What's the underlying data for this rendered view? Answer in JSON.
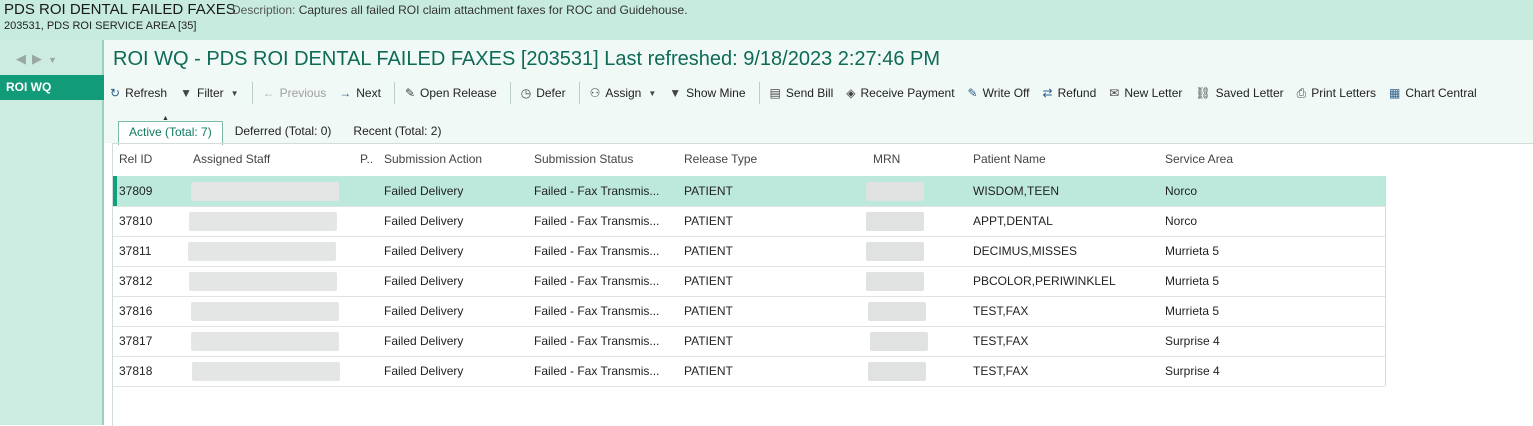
{
  "topbar": {
    "wq_name": "PDS ROI DENTAL FAILED FAXES",
    "description_label": "Description:",
    "description": "Captures all failed ROI claim attachment faxes for ROC and Guidehouse.",
    "subtitle": "203531, PDS ROI SERVICE AREA [35]"
  },
  "nav": {
    "back_icon": "back-arrow-icon",
    "forward_icon": "forward-arrow-icon",
    "menu_icon": "chevron-down-icon",
    "active_item": "ROI WQ"
  },
  "main": {
    "title": "ROI WQ - PDS ROI DENTAL FAILED FAXES [203531] Last refreshed: 9/18/2023 2:27:46 PM"
  },
  "toolbar": {
    "refresh": "Refresh",
    "filter": "Filter",
    "previous": "Previous",
    "next": "Next",
    "open_release": "Open Release",
    "defer": "Defer",
    "assign": "Assign",
    "show_mine": "Show Mine",
    "send_bill": "Send Bill",
    "receive_payment": "Receive Payment",
    "write_off": "Write Off",
    "refund": "Refund",
    "new_letter": "New Letter",
    "saved_letter": "Saved Letter",
    "print_letters": "Print Letters",
    "chart_central": "Chart Central"
  },
  "tabs": [
    {
      "label": "Active (Total: 7)"
    },
    {
      "label": "Deferred (Total: 0)"
    },
    {
      "label": "Recent (Total: 2)"
    }
  ],
  "columns": {
    "rel_id": "Rel ID",
    "assigned_staff": "Assigned Staff",
    "p": "P..",
    "submission_action": "Submission Action",
    "submission_status": "Submission Status",
    "release_type": "Release Type",
    "mrn": "MRN",
    "patient_name": "Patient Name",
    "service_area": "Service Area"
  },
  "rows": [
    {
      "rel_id": "37809",
      "action": "Failed Delivery",
      "status": "Failed - Fax Transmis...",
      "type": "PATIENT",
      "patient": "WISDOM,TEEN",
      "area": "Norco"
    },
    {
      "rel_id": "37810",
      "action": "Failed Delivery",
      "status": "Failed - Fax Transmis...",
      "type": "PATIENT",
      "patient": "APPT,DENTAL",
      "area": "Norco"
    },
    {
      "rel_id": "37811",
      "action": "Failed Delivery",
      "status": "Failed - Fax Transmis...",
      "type": "PATIENT",
      "patient": "DECIMUS,MISSES",
      "area": "Murrieta 5"
    },
    {
      "rel_id": "37812",
      "action": "Failed Delivery",
      "status": "Failed - Fax Transmis...",
      "type": "PATIENT",
      "patient": "PBCOLOR,PERIWINKLEL",
      "area": "Murrieta 5"
    },
    {
      "rel_id": "37816",
      "action": "Failed Delivery",
      "status": "Failed - Fax Transmis...",
      "type": "PATIENT",
      "patient": "TEST,FAX",
      "area": "Murrieta 5"
    },
    {
      "rel_id": "37817",
      "action": "Failed Delivery",
      "status": "Failed - Fax Transmis...",
      "type": "PATIENT",
      "patient": "TEST,FAX",
      "area": "Surprise 4"
    },
    {
      "rel_id": "37818",
      "action": "Failed Delivery",
      "status": "Failed - Fax Transmis...",
      "type": "PATIENT",
      "patient": "TEST,FAX",
      "area": "Surprise 4"
    }
  ],
  "colors": {
    "accent": "#129b78",
    "title": "#0e6a56",
    "topbar": "#c7ebde",
    "selected_row": "#bde8dc"
  }
}
